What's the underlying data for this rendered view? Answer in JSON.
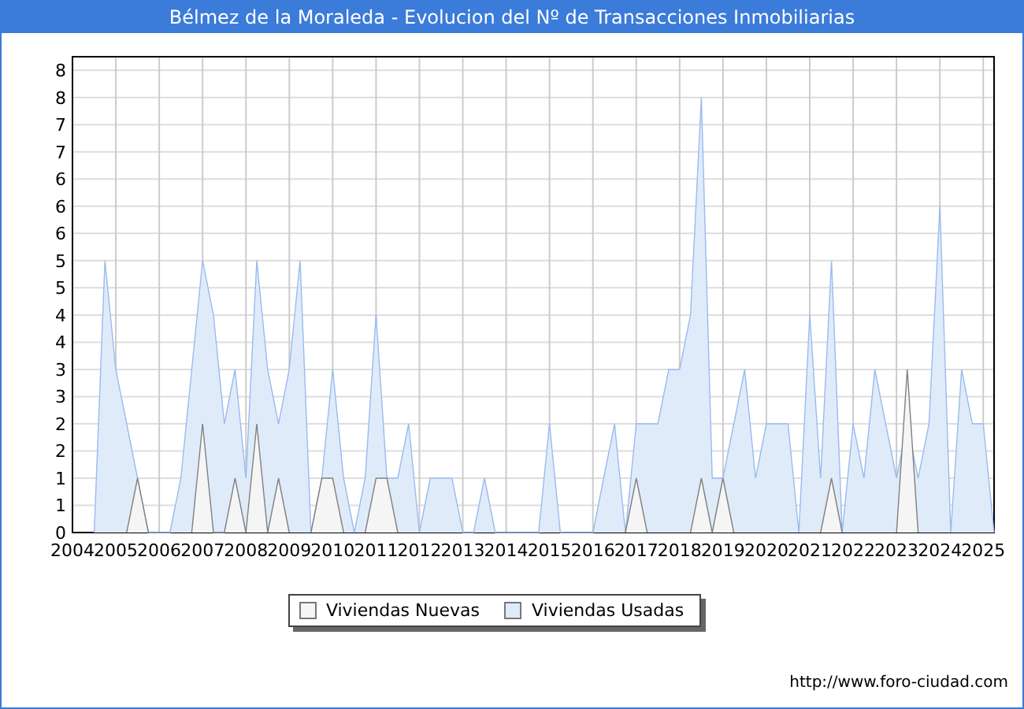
{
  "window": {
    "title": "Bélmez de la Moraleda - Evolucion del Nº de Transacciones Inmobiliarias"
  },
  "chart": {
    "chart_data": {
      "type": "area",
      "grid": true,
      "xlim": [
        2004,
        2025.25
      ],
      "ylim": [
        0,
        8.75
      ],
      "xticks": [
        2004,
        2005,
        2006,
        2007,
        2008,
        2009,
        2010,
        2011,
        2012,
        2013,
        2014,
        2015,
        2016,
        2017,
        2018,
        2019,
        2020,
        2021,
        2022,
        2023,
        2024,
        2025
      ],
      "yticks": [
        {
          "value": 0,
          "label": "0"
        },
        {
          "value": 0.5,
          "label": "1"
        },
        {
          "value": 1,
          "label": "1"
        },
        {
          "value": 1.5,
          "label": "2"
        },
        {
          "value": 2,
          "label": "2"
        },
        {
          "value": 2.5,
          "label": "3"
        },
        {
          "value": 3,
          "label": "3"
        },
        {
          "value": 3.5,
          "label": "4"
        },
        {
          "value": 4,
          "label": "4"
        },
        {
          "value": 4.5,
          "label": "5"
        },
        {
          "value": 5,
          "label": "5"
        },
        {
          "value": 5.5,
          "label": "6"
        },
        {
          "value": 6,
          "label": "6"
        },
        {
          "value": 6.5,
          "label": "6"
        },
        {
          "value": 7,
          "label": "7"
        },
        {
          "value": 7.5,
          "label": "7"
        },
        {
          "value": 8,
          "label": "8"
        },
        {
          "value": 8.5,
          "label": "8"
        }
      ],
      "x": [
        2004.5,
        2004.75,
        2005,
        2005.25,
        2005.5,
        2005.75,
        2006.25,
        2006.5,
        2006.75,
        2007,
        2007.25,
        2007.5,
        2007.75,
        2008,
        2008.25,
        2008.5,
        2008.75,
        2009,
        2009.25,
        2009.5,
        2009.75,
        2010,
        2010.25,
        2010.5,
        2010.75,
        2011,
        2011.25,
        2011.5,
        2011.75,
        2012,
        2012.25,
        2012.5,
        2012.75,
        2013,
        2013.25,
        2013.5,
        2013.75,
        2014.75,
        2015,
        2015.25,
        2016,
        2016.25,
        2016.5,
        2016.75,
        2017,
        2017.25,
        2017.5,
        2017.75,
        2018,
        2018.25,
        2018.5,
        2018.75,
        2019,
        2019.25,
        2019.5,
        2019.75,
        2020,
        2020.25,
        2020.5,
        2020.75,
        2021,
        2021.25,
        2021.5,
        2021.75,
        2022,
        2022.25,
        2022.5,
        2022.75,
        2023,
        2023.25,
        2023.5,
        2023.75,
        2024,
        2024.25,
        2024.5,
        2024.75,
        2025,
        2025.25
      ],
      "series": [
        {
          "name": "Viviendas Nuevas",
          "color": "#808080",
          "values": [
            null,
            null,
            null,
            0,
            1,
            0,
            null,
            null,
            0,
            2,
            0,
            0,
            1,
            0,
            2,
            0,
            1,
            0,
            null,
            0,
            1,
            1,
            0,
            null,
            0,
            1,
            1,
            0,
            null,
            null,
            null,
            null,
            null,
            null,
            null,
            null,
            null,
            null,
            null,
            null,
            null,
            null,
            null,
            0,
            1,
            0,
            null,
            null,
            null,
            0,
            1,
            0,
            1,
            0,
            null,
            null,
            null,
            null,
            null,
            null,
            null,
            0,
            1,
            0,
            null,
            null,
            null,
            null,
            0,
            3,
            0,
            null,
            null,
            null,
            null,
            null,
            null,
            null
          ]
        },
        {
          "name": "Viviendas Usadas",
          "color": "#99bbee",
          "values": [
            0,
            5,
            3,
            2,
            1,
            0,
            0,
            1,
            3,
            5,
            4,
            2,
            3,
            1,
            5,
            3,
            2,
            3,
            5,
            0,
            1,
            3,
            1,
            0,
            1,
            4,
            1,
            1,
            2,
            0,
            1,
            1,
            1,
            0,
            0,
            1,
            0,
            0,
            2,
            0,
            0,
            1,
            2,
            0,
            2,
            2,
            2,
            3,
            3,
            4,
            8,
            1,
            1,
            2,
            3,
            1,
            2,
            2,
            2,
            0,
            4,
            1,
            5,
            0,
            2,
            1,
            3,
            2,
            1,
            2,
            1,
            2,
            6,
            0,
            3,
            2,
            2,
            0
          ]
        }
      ]
    }
  },
  "footer": {
    "url": "http://www.foro-ciudad.com"
  }
}
